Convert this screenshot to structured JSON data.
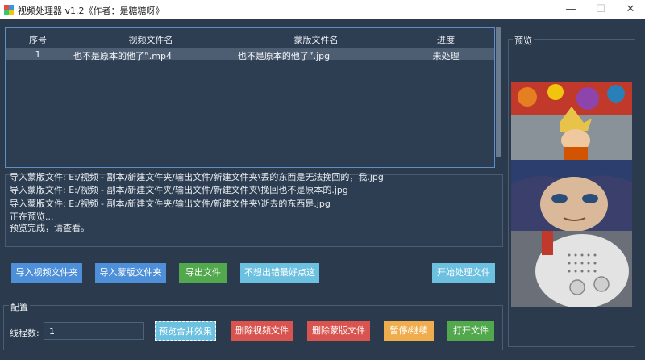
{
  "window": {
    "title": "视频处理器 v1.2《作者：是糖糖呀》",
    "minimize": "—",
    "maximize": "☐",
    "close": "✕"
  },
  "table": {
    "columns": [
      "序号",
      "视频文件名",
      "蒙版文件名",
      "进度"
    ],
    "rows": [
      {
        "index": "1",
        "video": "也不是原本的他了”.mp4",
        "mask": "也不是原本的他了”.jpg",
        "status": "未处理"
      }
    ]
  },
  "log": {
    "lines": [
      "导入蒙版文件: E:/视频 - 副本/新建文件夹/输出文件/新建文件夹\\丢的东西是无法挽回的，我.jpg",
      "导入蒙版文件: E:/视频 - 副本/新建文件夹/输出文件/新建文件夹\\挽回也不是原本的.jpg",
      "导入蒙版文件: E:/视频 - 副本/新建文件夹/输出文件/新建文件夹\\逝去的东西是.jpg",
      "正在预览...",
      "预览完成，请查看。"
    ]
  },
  "actions": {
    "import_video": "导入视频文件夹",
    "import_mask": "导入蒙版文件夹",
    "export": "导出文件",
    "dont_click": "不想出错最好点这",
    "start": "开始处理文件"
  },
  "config": {
    "title": "配置",
    "threads_label": "线程数:",
    "threads_value": "1",
    "preview_merge": "预览合并效果",
    "delete_video": "删除视频文件",
    "delete_mask": "删除蒙版文件",
    "pause": "暂停/继续",
    "open_file": "打开文件"
  },
  "preview": {
    "title": "预览"
  },
  "colors": {
    "background": "#2b3a4d",
    "blue_button": "#4d8fd8",
    "green_button": "#52a84c",
    "teal_button": "#6cc0e0",
    "red_button": "#d9534f",
    "orange_button": "#f0ad4e"
  }
}
